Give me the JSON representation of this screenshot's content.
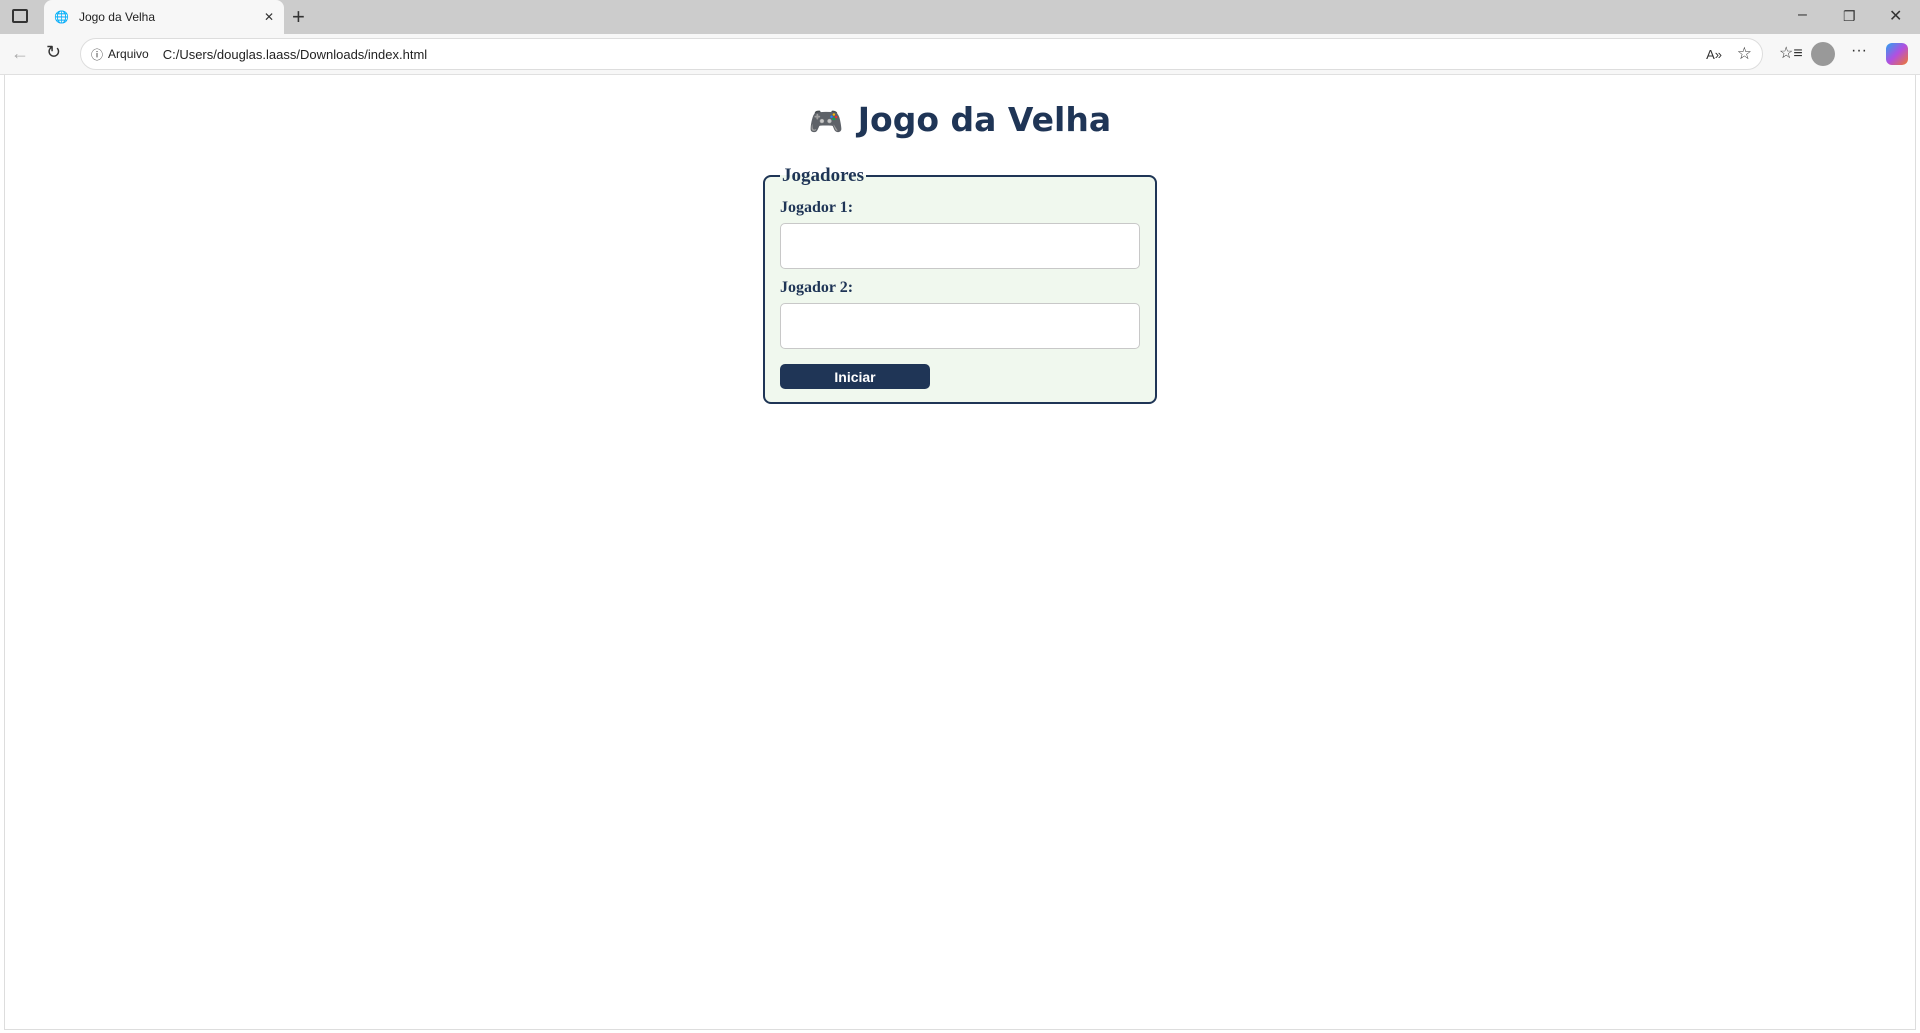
{
  "browser": {
    "tab_title": "Jogo da Velha",
    "address_prefix": "Arquivo",
    "url": "C:/Users/douglas.laass/Downloads/index.html"
  },
  "page": {
    "title_icon": "🎮",
    "title": "Jogo da Velha",
    "legend": "Jogadores",
    "player1_label": "Jogador 1:",
    "player1_value": "",
    "player2_label": "Jogador 2:",
    "player2_value": "",
    "start_button": "Iniciar"
  },
  "colors": {
    "primary": "#1f3556",
    "form_bg": "#f0f8ee"
  }
}
